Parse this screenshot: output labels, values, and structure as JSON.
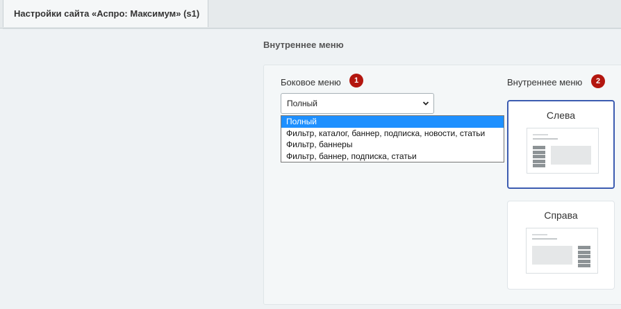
{
  "tabs": [
    {
      "label": "Настройки сайта «Аспро: Максимум» (s1)",
      "active": true
    }
  ],
  "section": {
    "title": "Внутреннее меню"
  },
  "side_menu": {
    "label": "Боковое меню",
    "badge": "1",
    "selected": "Полный",
    "options": [
      "Полный",
      "Фильтр, каталог, баннер, подписка, новости, статьи",
      "Фильтр, баннеры",
      "Фильтр, баннер, подписка, статьи"
    ]
  },
  "inner_menu": {
    "label": "Внутреннее меню",
    "badge": "2",
    "cards": [
      {
        "title": "Слева",
        "active": true
      },
      {
        "title": "Справа",
        "active": false
      }
    ]
  },
  "colors": {
    "badge": "#b3160f",
    "selected_option": "#1e90ff",
    "active_card_border": "#3b5bb0"
  },
  "icons": {
    "select_arrow": "chevron-down-icon"
  }
}
